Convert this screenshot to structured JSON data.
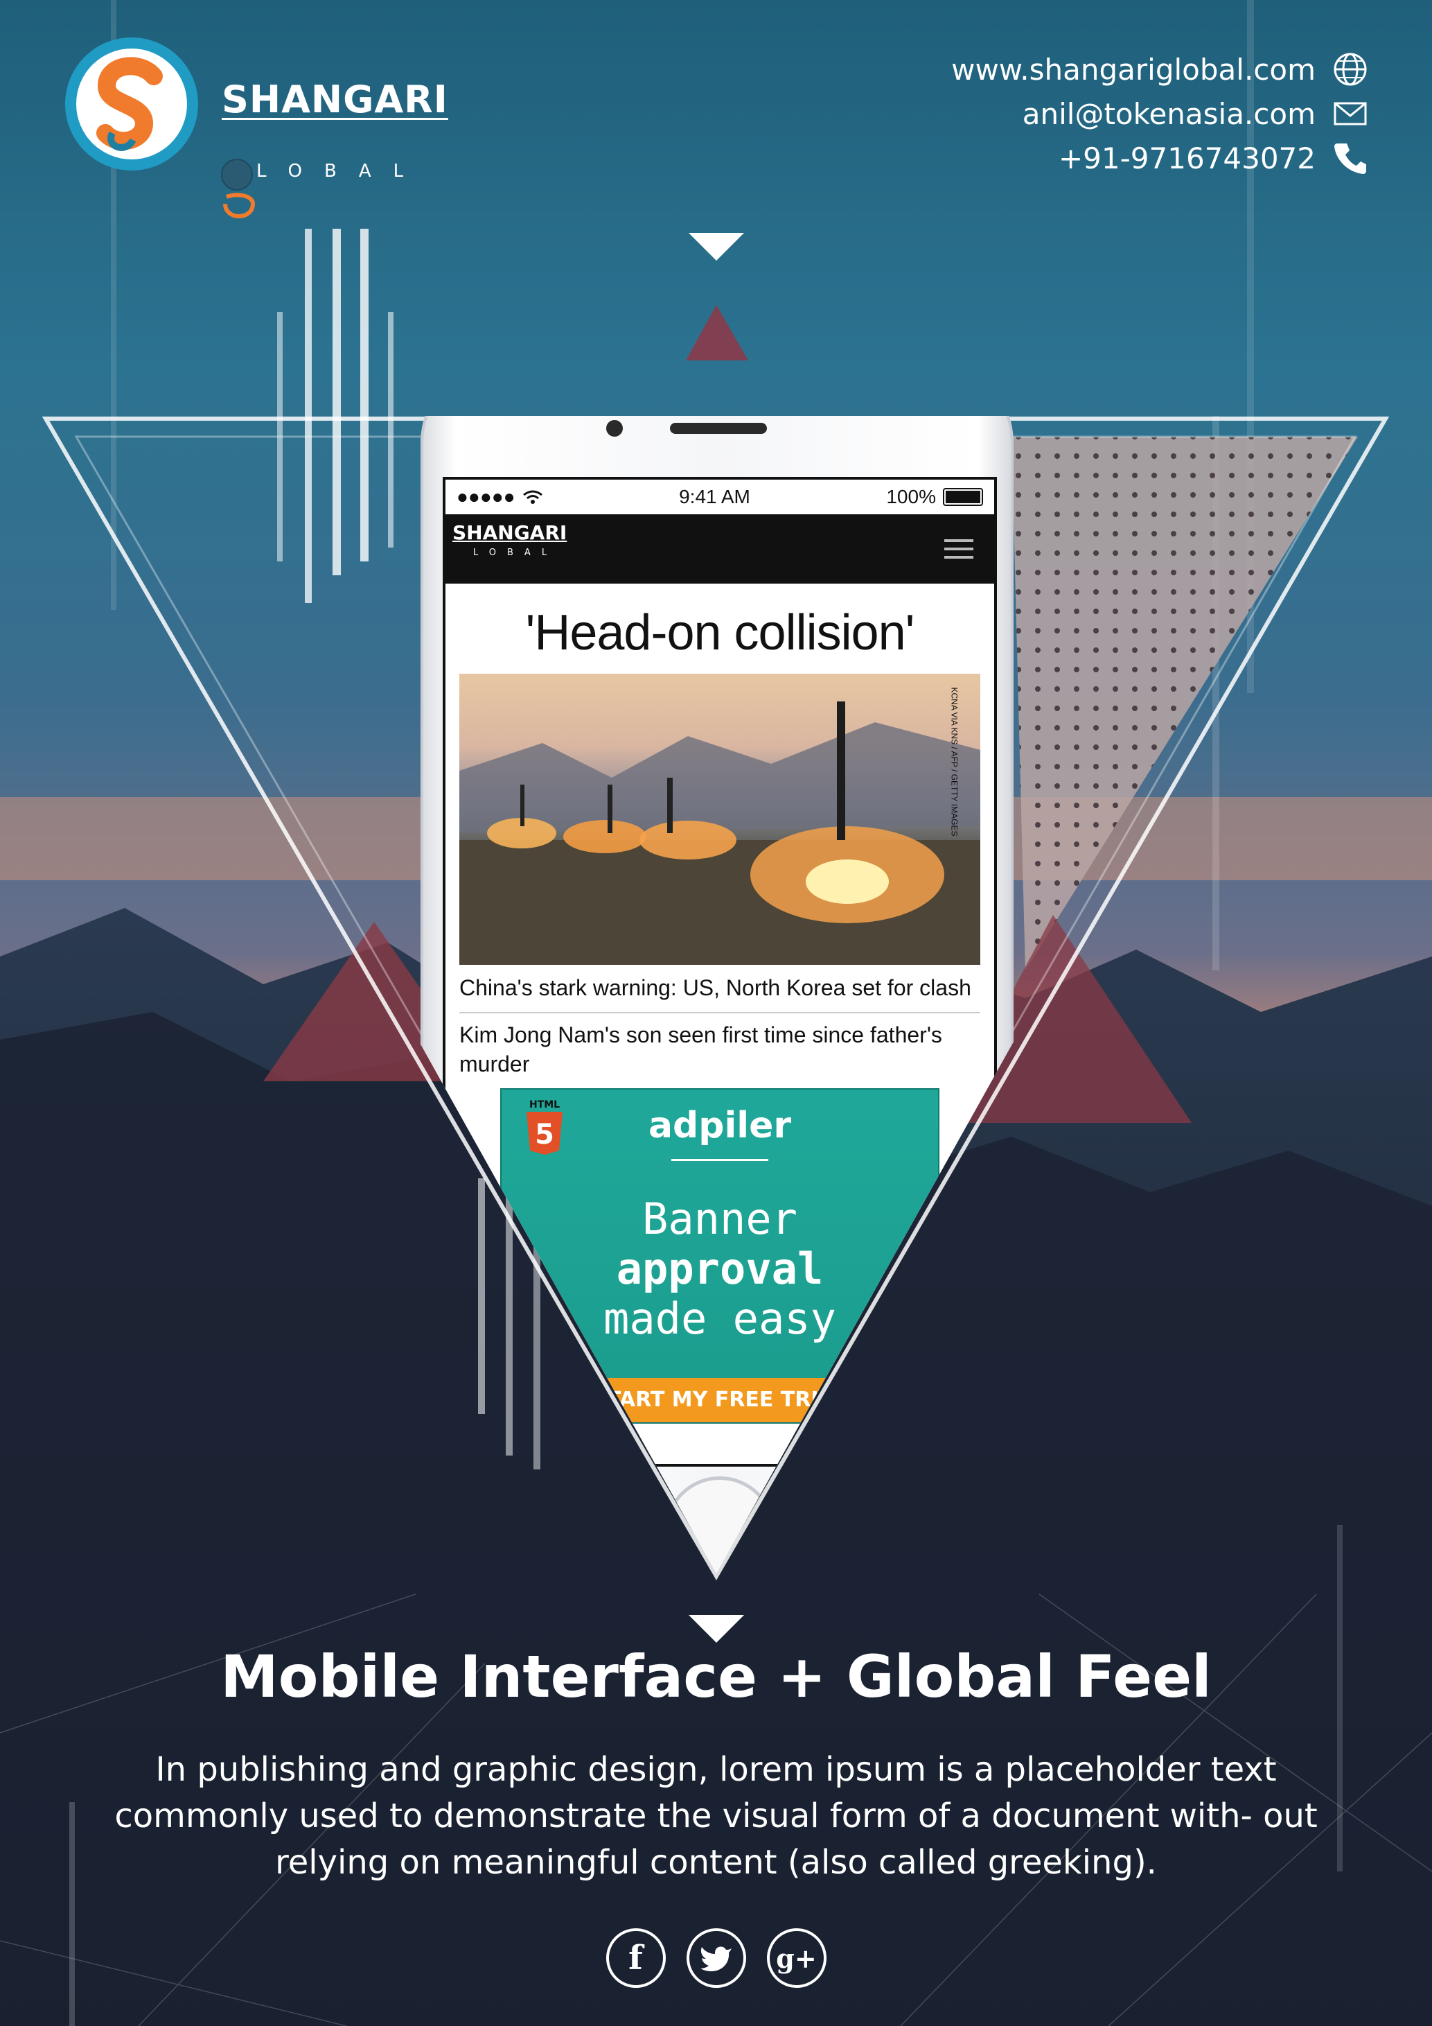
{
  "brand": {
    "name": "SHANGARI",
    "sub": "LOBAL"
  },
  "contact": {
    "website": "www.shangariglobal.com",
    "email": "anil@tokenasia.com",
    "phone": "+91-9716743072"
  },
  "phone_ui": {
    "status_time": "9:41 AM",
    "status_battery": "100%",
    "site_logo": "SHANGARI",
    "site_logo_sub": "LOBAL",
    "headline": "'Head-on collision'",
    "image_credit": "KCNA VIA KNS / AFP / GETTY IMAGES",
    "story1": "China's stark warning: US, North Korea set for clash",
    "story2": "Kim Jong Nam's son seen first time since father's murder",
    "ad": {
      "html5_label": "HTML",
      "brand": "adpiler",
      "line1": "Banner",
      "line2": "approval",
      "line3": "made easy",
      "cta": "START MY FREE TRIAL"
    }
  },
  "main": {
    "title": "Mobile Interface + Global Feel",
    "description": "In publishing and graphic design, lorem ipsum is a placeholder text commonly used to demonstrate the visual form of a document with- out relying on meaningful content (also called greeking)."
  },
  "social": [
    {
      "name": "facebook-icon",
      "glyph": "f"
    },
    {
      "name": "twitter-icon",
      "glyph": "t"
    },
    {
      "name": "google-plus-icon",
      "glyph": "g+"
    }
  ],
  "colors": {
    "accent_orange": "#f07b2d",
    "logo_teal": "#1f7fa0",
    "ad_teal": "#1fa89a",
    "ad_cta": "#f39a1e"
  }
}
